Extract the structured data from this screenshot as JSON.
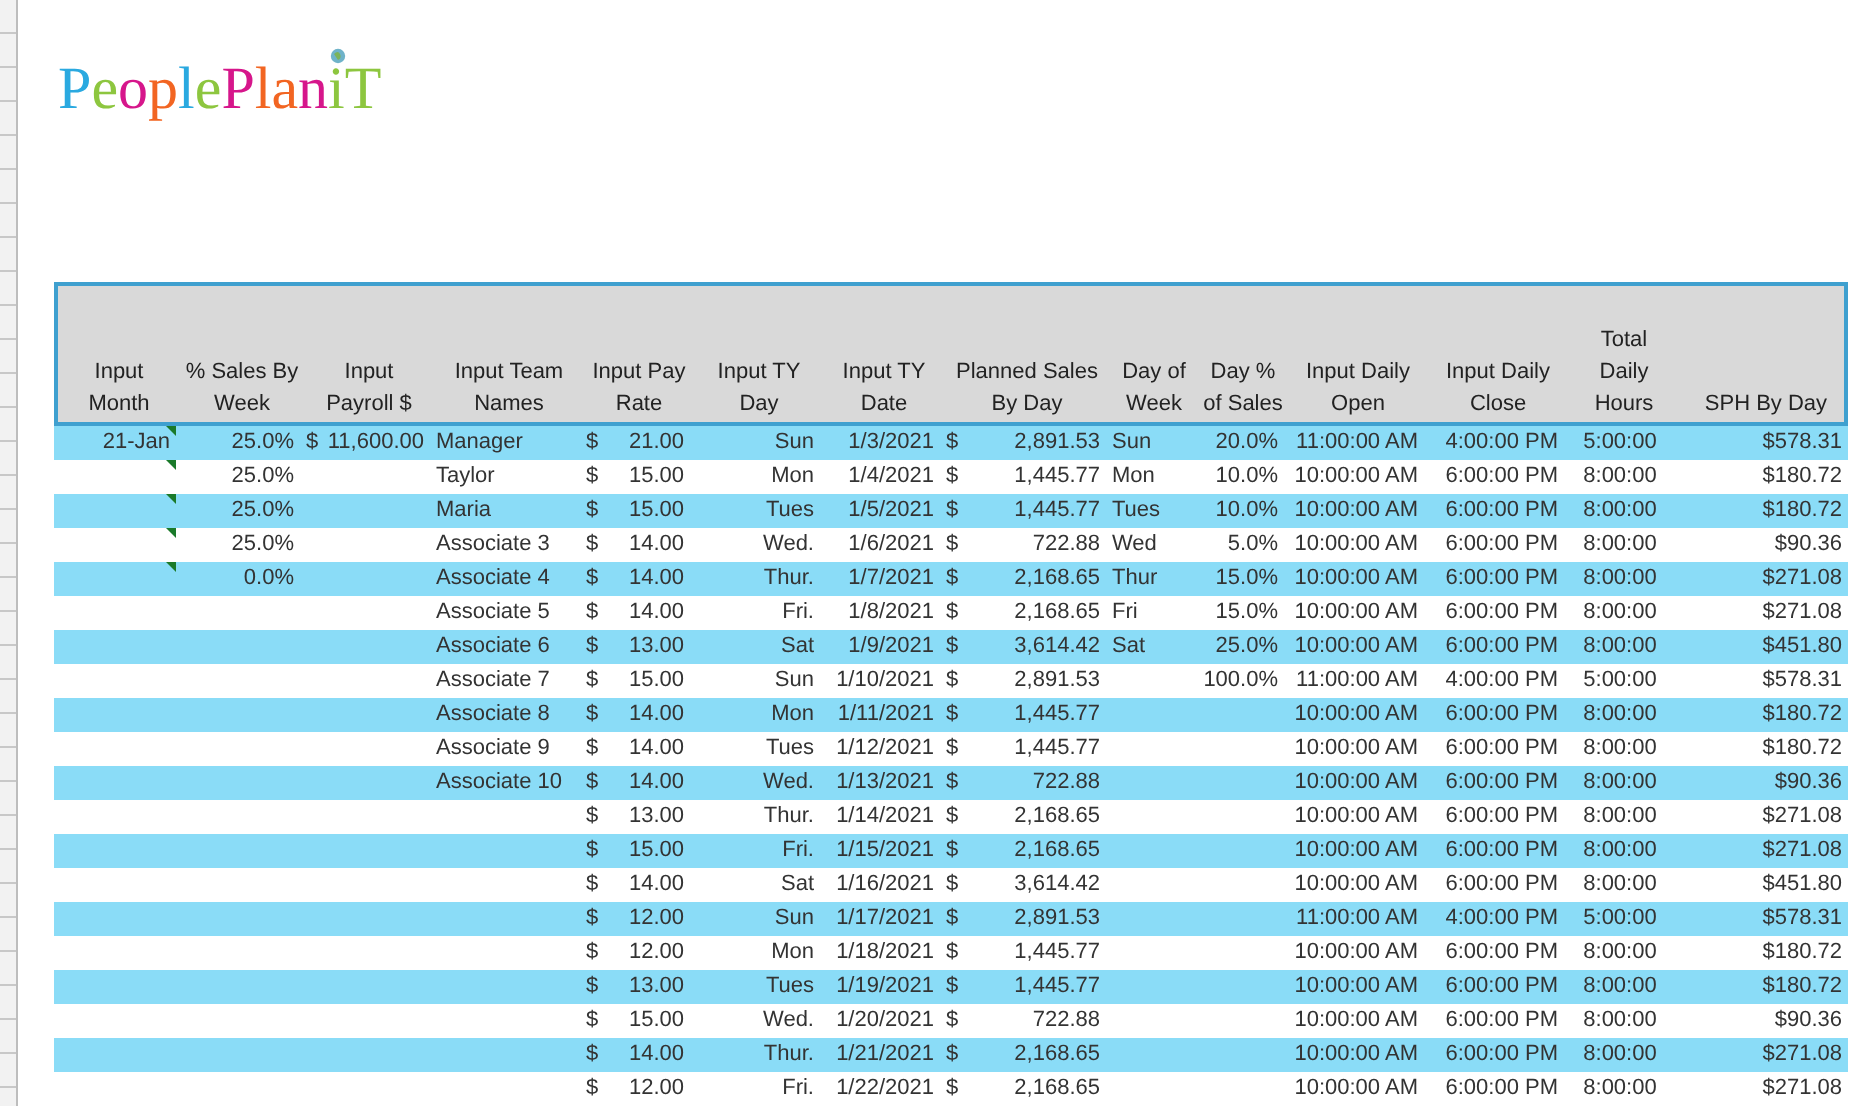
{
  "logo": {
    "letters": [
      {
        "text": "P",
        "color": "#2aa9e0"
      },
      {
        "text": "e",
        "color": "#8dc63f"
      },
      {
        "text": "o",
        "color": "#d6168b"
      },
      {
        "text": "p",
        "color": "#f26522"
      },
      {
        "text": "l",
        "color": "#2aa9e0"
      },
      {
        "text": "e",
        "color": "#8dc63f"
      },
      {
        "text": "P",
        "color": "#d6168b"
      },
      {
        "text": "l",
        "color": "#f26522"
      },
      {
        "text": "a",
        "color": "#f26522"
      },
      {
        "text": "n",
        "color": "#d6168b"
      },
      {
        "text": "i",
        "color": "#8dc63f"
      },
      {
        "text": "T",
        "color": "#8dc63f"
      }
    ]
  },
  "table": {
    "columns": [
      "Input Month",
      "% Sales By Week",
      "Input Payroll $",
      "Input Team Names",
      "Input Pay Rate",
      "Input TY Day",
      "Input TY Date",
      "Planned Sales By Day",
      "Day of Week",
      "Day % of Sales",
      "Input Daily Open",
      "Input Daily Close",
      "Total Daily Hours",
      "SPH By Day"
    ],
    "rows": [
      {
        "highlighted": true,
        "flagged": true,
        "month": "21-Jan",
        "sales_by_week": "25.0%",
        "payroll": {
          "symbol": "$",
          "amount": "11,600.00"
        },
        "team_name": "Manager",
        "pay_rate": {
          "symbol": "$",
          "amount": "21.00"
        },
        "ty_day": "Sun",
        "ty_date": "1/3/2021",
        "planned_sales": {
          "symbol": "$",
          "amount": "2,891.53"
        },
        "day_of_week": "Sun",
        "day_pct": "20.0%",
        "open": "11:00:00 AM",
        "close": "4:00:00 PM",
        "hours": "5:00:00",
        "sph": "$578.31"
      },
      {
        "highlighted": false,
        "flagged": true,
        "sales_by_week": "25.0%",
        "team_name": "Taylor",
        "pay_rate": {
          "symbol": "$",
          "amount": "15.00"
        },
        "ty_day": "Mon",
        "ty_date": "1/4/2021",
        "planned_sales": {
          "symbol": "$",
          "amount": "1,445.77"
        },
        "day_of_week": "Mon",
        "day_pct": "10.0%",
        "open": "10:00:00 AM",
        "close": "6:00:00 PM",
        "hours": "8:00:00",
        "sph": "$180.72"
      },
      {
        "highlighted": true,
        "flagged": true,
        "sales_by_week": "25.0%",
        "team_name": "Maria",
        "pay_rate": {
          "symbol": "$",
          "amount": "15.00"
        },
        "ty_day": "Tues",
        "ty_date": "1/5/2021",
        "planned_sales": {
          "symbol": "$",
          "amount": "1,445.77"
        },
        "day_of_week": "Tues",
        "day_pct": "10.0%",
        "open": "10:00:00 AM",
        "close": "6:00:00 PM",
        "hours": "8:00:00",
        "sph": "$180.72"
      },
      {
        "highlighted": false,
        "flagged": true,
        "sales_by_week": "25.0%",
        "team_name": "Associate 3",
        "pay_rate": {
          "symbol": "$",
          "amount": "14.00"
        },
        "ty_day": "Wed.",
        "ty_date": "1/6/2021",
        "planned_sales": {
          "symbol": "$",
          "amount": "722.88"
        },
        "day_of_week": "Wed",
        "day_pct": "5.0%",
        "open": "10:00:00 AM",
        "close": "6:00:00 PM",
        "hours": "8:00:00",
        "sph": "$90.36"
      },
      {
        "highlighted": true,
        "flagged": true,
        "sales_by_week": "0.0%",
        "team_name": "Associate 4",
        "pay_rate": {
          "symbol": "$",
          "amount": "14.00"
        },
        "ty_day": "Thur.",
        "ty_date": "1/7/2021",
        "planned_sales": {
          "symbol": "$",
          "amount": "2,168.65"
        },
        "day_of_week": "Thur",
        "day_pct": "15.0%",
        "open": "10:00:00 AM",
        "close": "6:00:00 PM",
        "hours": "8:00:00",
        "sph": "$271.08"
      },
      {
        "highlighted": false,
        "flagged": false,
        "team_name": "Associate 5",
        "pay_rate": {
          "symbol": "$",
          "amount": "14.00"
        },
        "ty_day": "Fri.",
        "ty_date": "1/8/2021",
        "planned_sales": {
          "symbol": "$",
          "amount": "2,168.65"
        },
        "day_of_week": "Fri",
        "day_pct": "15.0%",
        "open": "10:00:00 AM",
        "close": "6:00:00 PM",
        "hours": "8:00:00",
        "sph": "$271.08"
      },
      {
        "highlighted": true,
        "flagged": false,
        "team_name": "Associate 6",
        "pay_rate": {
          "symbol": "$",
          "amount": "13.00"
        },
        "ty_day": "Sat",
        "ty_date": "1/9/2021",
        "planned_sales": {
          "symbol": "$",
          "amount": "3,614.42"
        },
        "day_of_week": "Sat",
        "day_pct": "25.0%",
        "open": "10:00:00 AM",
        "close": "6:00:00 PM",
        "hours": "8:00:00",
        "sph": "$451.80"
      },
      {
        "highlighted": false,
        "flagged": false,
        "team_name": "Associate 7",
        "pay_rate": {
          "symbol": "$",
          "amount": "15.00"
        },
        "ty_day": "Sun",
        "ty_date": "1/10/2021",
        "planned_sales": {
          "symbol": "$",
          "amount": "2,891.53"
        },
        "day_pct": "100.0%",
        "open": "11:00:00 AM",
        "close": "4:00:00 PM",
        "hours": "5:00:00",
        "sph": "$578.31"
      },
      {
        "highlighted": true,
        "flagged": false,
        "team_name": "Associate 8",
        "pay_rate": {
          "symbol": "$",
          "amount": "14.00"
        },
        "ty_day": "Mon",
        "ty_date": "1/11/2021",
        "planned_sales": {
          "symbol": "$",
          "amount": "1,445.77"
        },
        "open": "10:00:00 AM",
        "close": "6:00:00 PM",
        "hours": "8:00:00",
        "sph": "$180.72"
      },
      {
        "highlighted": false,
        "flagged": false,
        "team_name": "Associate 9",
        "pay_rate": {
          "symbol": "$",
          "amount": "14.00"
        },
        "ty_day": "Tues",
        "ty_date": "1/12/2021",
        "planned_sales": {
          "symbol": "$",
          "amount": "1,445.77"
        },
        "open": "10:00:00 AM",
        "close": "6:00:00 PM",
        "hours": "8:00:00",
        "sph": "$180.72"
      },
      {
        "highlighted": true,
        "flagged": false,
        "team_name": "Associate 10",
        "pay_rate": {
          "symbol": "$",
          "amount": "14.00"
        },
        "ty_day": "Wed.",
        "ty_date": "1/13/2021",
        "planned_sales": {
          "symbol": "$",
          "amount": "722.88"
        },
        "open": "10:00:00 AM",
        "close": "6:00:00 PM",
        "hours": "8:00:00",
        "sph": "$90.36"
      },
      {
        "highlighted": false,
        "flagged": false,
        "pay_rate": {
          "symbol": "$",
          "amount": "13.00"
        },
        "ty_day": "Thur.",
        "ty_date": "1/14/2021",
        "planned_sales": {
          "symbol": "$",
          "amount": "2,168.65"
        },
        "open": "10:00:00 AM",
        "close": "6:00:00 PM",
        "hours": "8:00:00",
        "sph": "$271.08"
      },
      {
        "highlighted": true,
        "flagged": false,
        "pay_rate": {
          "symbol": "$",
          "amount": "15.00"
        },
        "ty_day": "Fri.",
        "ty_date": "1/15/2021",
        "planned_sales": {
          "symbol": "$",
          "amount": "2,168.65"
        },
        "open": "10:00:00 AM",
        "close": "6:00:00 PM",
        "hours": "8:00:00",
        "sph": "$271.08"
      },
      {
        "highlighted": false,
        "flagged": false,
        "pay_rate": {
          "symbol": "$",
          "amount": "14.00"
        },
        "ty_day": "Sat",
        "ty_date": "1/16/2021",
        "planned_sales": {
          "symbol": "$",
          "amount": "3,614.42"
        },
        "open": "10:00:00 AM",
        "close": "6:00:00 PM",
        "hours": "8:00:00",
        "sph": "$451.80"
      },
      {
        "highlighted": true,
        "flagged": false,
        "pay_rate": {
          "symbol": "$",
          "amount": "12.00"
        },
        "ty_day": "Sun",
        "ty_date": "1/17/2021",
        "planned_sales": {
          "symbol": "$",
          "amount": "2,891.53"
        },
        "open": "11:00:00 AM",
        "close": "4:00:00 PM",
        "hours": "5:00:00",
        "sph": "$578.31"
      },
      {
        "highlighted": false,
        "flagged": false,
        "pay_rate": {
          "symbol": "$",
          "amount": "12.00"
        },
        "ty_day": "Mon",
        "ty_date": "1/18/2021",
        "planned_sales": {
          "symbol": "$",
          "amount": "1,445.77"
        },
        "open": "10:00:00 AM",
        "close": "6:00:00 PM",
        "hours": "8:00:00",
        "sph": "$180.72"
      },
      {
        "highlighted": true,
        "flagged": false,
        "pay_rate": {
          "symbol": "$",
          "amount": "13.00"
        },
        "ty_day": "Tues",
        "ty_date": "1/19/2021",
        "planned_sales": {
          "symbol": "$",
          "amount": "1,445.77"
        },
        "open": "10:00:00 AM",
        "close": "6:00:00 PM",
        "hours": "8:00:00",
        "sph": "$180.72"
      },
      {
        "highlighted": false,
        "flagged": false,
        "pay_rate": {
          "symbol": "$",
          "amount": "15.00"
        },
        "ty_day": "Wed.",
        "ty_date": "1/20/2021",
        "planned_sales": {
          "symbol": "$",
          "amount": "722.88"
        },
        "open": "10:00:00 AM",
        "close": "6:00:00 PM",
        "hours": "8:00:00",
        "sph": "$90.36"
      },
      {
        "highlighted": true,
        "flagged": false,
        "pay_rate": {
          "symbol": "$",
          "amount": "14.00"
        },
        "ty_day": "Thur.",
        "ty_date": "1/21/2021",
        "planned_sales": {
          "symbol": "$",
          "amount": "2,168.65"
        },
        "open": "10:00:00 AM",
        "close": "6:00:00 PM",
        "hours": "8:00:00",
        "sph": "$271.08"
      },
      {
        "highlighted": false,
        "flagged": false,
        "pay_rate": {
          "symbol": "$",
          "amount": "12.00"
        },
        "ty_day": "Fri.",
        "ty_date": "1/22/2021",
        "planned_sales": {
          "symbol": "$",
          "amount": "2,168.65"
        },
        "open": "10:00:00 AM",
        "close": "6:00:00 PM",
        "hours": "8:00:00",
        "sph": "$271.08"
      }
    ]
  }
}
